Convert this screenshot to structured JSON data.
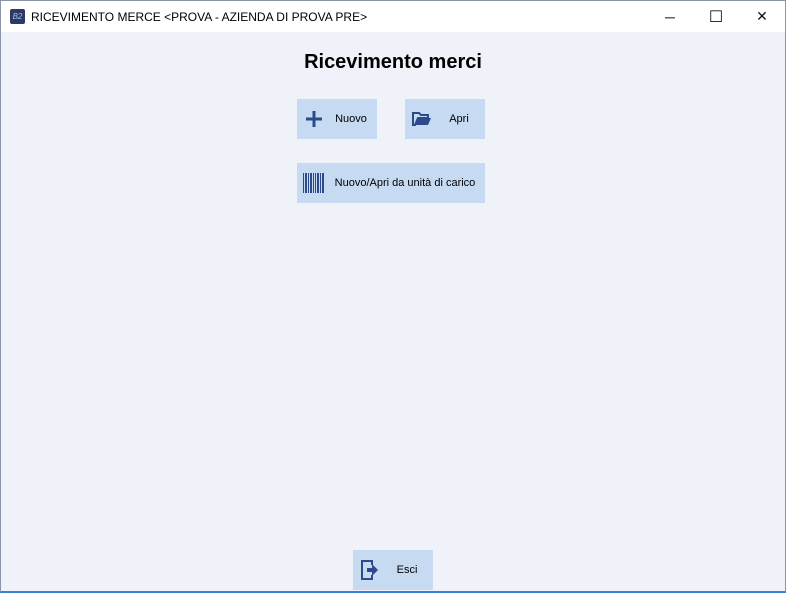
{
  "window": {
    "title": "RICEVIMENTO MERCE <PROVA - AZIENDA DI PROVA PRE>",
    "app_icon_text": "B2",
    "minimize": "─",
    "maximize": "☐",
    "close": "✕"
  },
  "main": {
    "heading": "Ricevimento merci",
    "buttons": {
      "new": "Nuovo",
      "open": "Apri",
      "load_unit": "Nuovo/Apri da unità di carico",
      "exit": "Esci"
    }
  },
  "colors": {
    "button_bg": "#c6daf2",
    "icon": "#2d4a8a",
    "content_bg": "#eff2f9"
  }
}
